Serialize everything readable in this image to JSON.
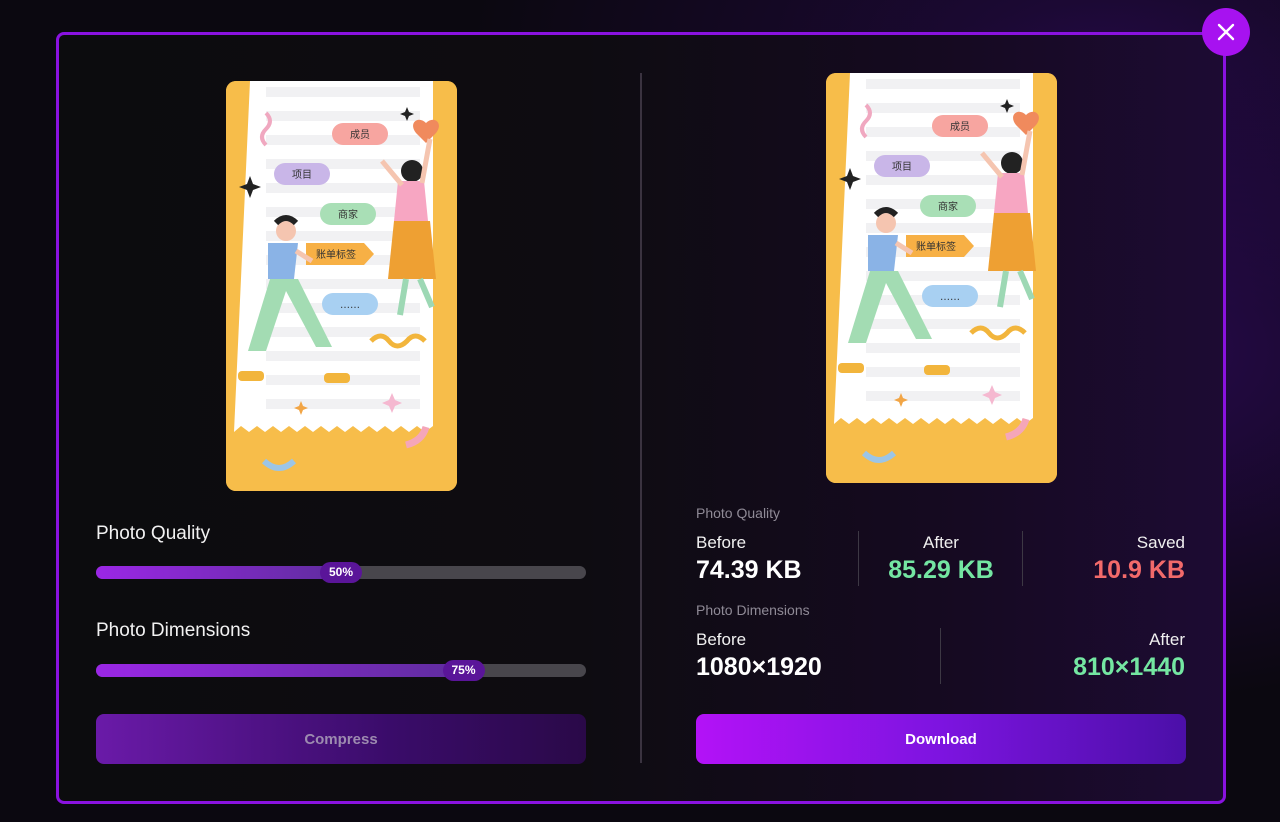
{
  "dialog": {
    "close_icon": "close-icon"
  },
  "preview_image": {
    "tags": [
      "成员",
      "项目",
      "商家",
      "账单标签",
      "……"
    ]
  },
  "controls": {
    "quality_label": "Photo Quality",
    "quality_value": "50%",
    "quality_level": 0.5,
    "dimensions_label": "Photo Dimensions",
    "dimensions_value": "75%",
    "dimensions_level": 0.75,
    "compress_label": "Compress"
  },
  "results": {
    "quality_section": "Photo Quality",
    "before_label": "Before",
    "before_size": "74.39 KB",
    "after_label": "After",
    "after_size": "85.29 KB",
    "saved_label": "Saved",
    "saved_size": "10.9 KB",
    "dimensions_section": "Photo Dimensions",
    "dim_before_label": "Before",
    "dim_before_value": "1080×1920",
    "dim_after_label": "After",
    "dim_after_value": "810×1440",
    "download_label": "Download"
  },
  "colors": {
    "accent": "#a712f0",
    "border": "#8a12e0",
    "after_green": "#74e6a2",
    "saved_red": "#f26a6a"
  }
}
